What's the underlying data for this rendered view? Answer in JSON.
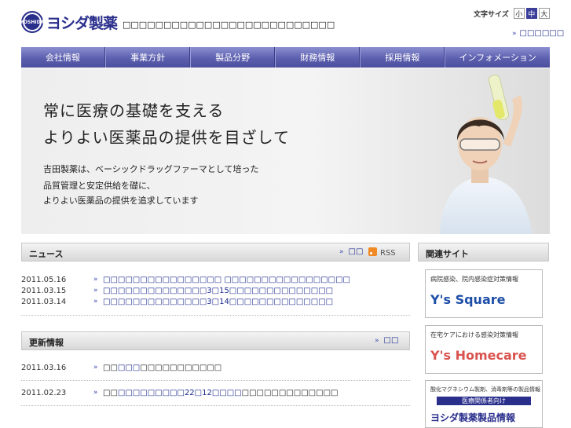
{
  "header": {
    "logo_mark": "YOSHIDA",
    "logo_text": "ヨシダ製薬",
    "tagline": "□□□□□□□□□□□□□□□□□□□□□□□□□□",
    "font_size_label": "文字サイズ",
    "font_sizes": [
      "小",
      "中",
      "大"
    ],
    "top_link": "□□□□□□"
  },
  "nav": {
    "items": [
      "会社情報",
      "事業方針",
      "製品分野",
      "財務情報",
      "採用情報",
      "インフォメーション"
    ]
  },
  "hero": {
    "headline_1": "常に医療の基礎を支える",
    "headline_2": "よりよい医薬品の提供を目ざして",
    "body_1": "吉田製薬は、ベーシックドラッグファーマとして培った",
    "body_2": "品質管理と安定供給を礎に、",
    "body_3": "よりよい医薬品の提供を追求しています"
  },
  "news": {
    "title": "ニュース",
    "list_link": "□□",
    "rss_label": "RSS",
    "items": [
      {
        "date": "2011.05.16",
        "text": "□□□□□□□□□□□□□□□□ □□□□□□□□□□□□□□□□□"
      },
      {
        "date": "2011.03.15",
        "text": "□□□□□□□□□□□□□□3□15□□□□□□□□□□□□□□"
      },
      {
        "date": "2011.03.14",
        "text": "□□□□□□□□□□□□□□3□14□□□□□□□□□□□□□□"
      }
    ]
  },
  "updates": {
    "title": "更新情報",
    "list_link": "□□",
    "items": [
      {
        "date": "2011.03.16",
        "plain_prefix": "□□",
        "link": "□□□",
        "plain_suffix": "□□□□□□□□□□□"
      },
      {
        "date": "2011.02.23",
        "plain_prefix": "□□",
        "link": "□□□□□□□□□22□12□□□□",
        "plain_suffix": "□□□□□□□□□□□□□"
      }
    ]
  },
  "side": {
    "title": "関連サイト",
    "banners": [
      {
        "caption": "病院感染、院内感染症対策情報",
        "logo": "Y's Square",
        "color": "#1e4fa8"
      },
      {
        "caption": "在宅ケアにおける感染対策情報",
        "logo": "Y's Homecare",
        "color": "#d9534f"
      },
      {
        "caption": "酸化マグネシウム製剤、消毒剤等の製品情報",
        "sub": "医療関係者向け",
        "logo": "ヨシダ製薬製品情報",
        "color": "#2a2f8c"
      }
    ]
  },
  "colors": {
    "nav": "#5c5fae",
    "link": "#1b2a8c",
    "brand": "#2a2f8c"
  }
}
